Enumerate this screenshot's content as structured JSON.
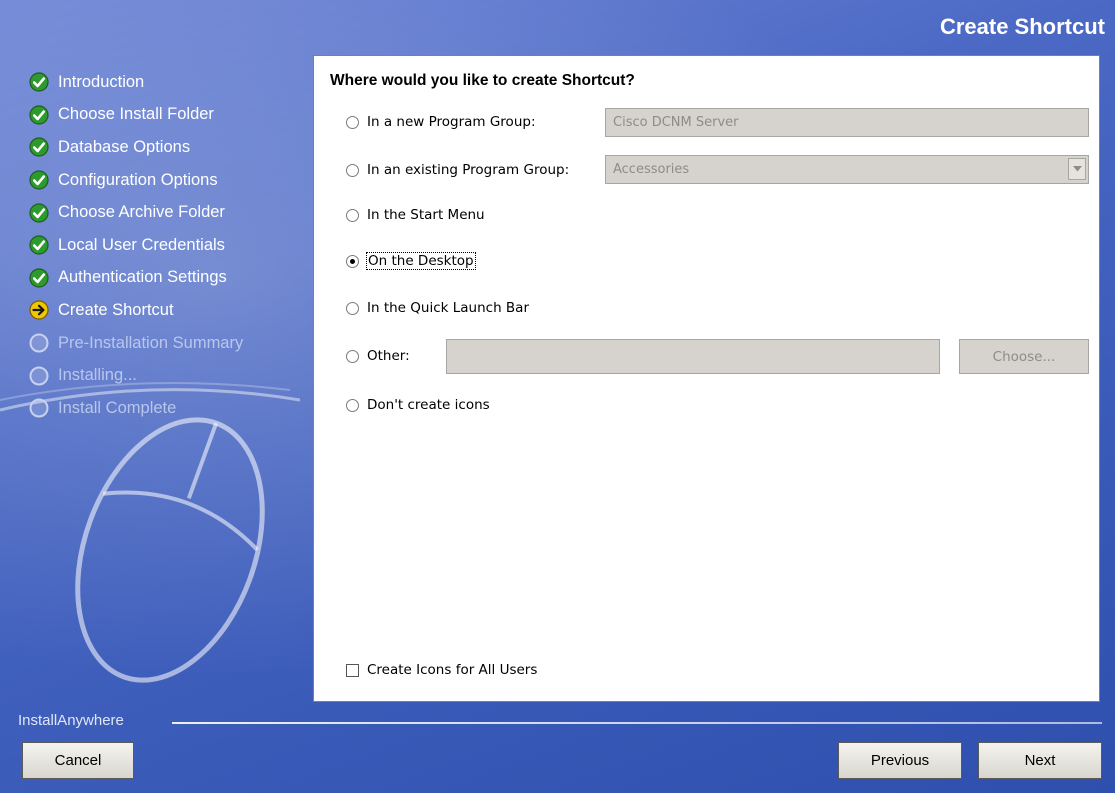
{
  "window": {
    "title": "Create Shortcut"
  },
  "steps": [
    {
      "label": "Introduction",
      "state": "done"
    },
    {
      "label": "Choose Install Folder",
      "state": "done"
    },
    {
      "label": "Database Options",
      "state": "done"
    },
    {
      "label": "Configuration Options",
      "state": "done"
    },
    {
      "label": "Choose Archive Folder",
      "state": "done"
    },
    {
      "label": "Local User Credentials",
      "state": "done"
    },
    {
      "label": "Authentication Settings",
      "state": "done"
    },
    {
      "label": "Create Shortcut",
      "state": "current"
    },
    {
      "label": "Pre-Installation Summary",
      "state": "pending"
    },
    {
      "label": "Installing...",
      "state": "pending"
    },
    {
      "label": "Install Complete",
      "state": "pending"
    }
  ],
  "panel": {
    "question": "Where would you like to create Shortcut?",
    "options": {
      "new_group": {
        "label": "In a new Program Group:",
        "value": "Cisco DCNM Server"
      },
      "existing_group": {
        "label": "In an existing Program Group:",
        "value": "Accessories"
      },
      "start_menu": {
        "label": "In the Start Menu"
      },
      "desktop": {
        "label": "On the Desktop",
        "checked": true
      },
      "quick_launch": {
        "label": "In the Quick Launch Bar"
      },
      "other": {
        "label": "Other:",
        "value": "",
        "choose_label": "Choose..."
      },
      "no_icons": {
        "label": "Don't create icons"
      }
    },
    "all_users": {
      "label": "Create Icons for All Users",
      "checked": false
    }
  },
  "footer": {
    "brand": "InstallAnywhere",
    "cancel_label": "Cancel",
    "previous_label": "Previous",
    "next_label": "Next"
  },
  "colors": {
    "done": "#2e9a2e",
    "current": "#f0c800",
    "pending": "#b9c6ec",
    "background": "#4a68c4"
  }
}
